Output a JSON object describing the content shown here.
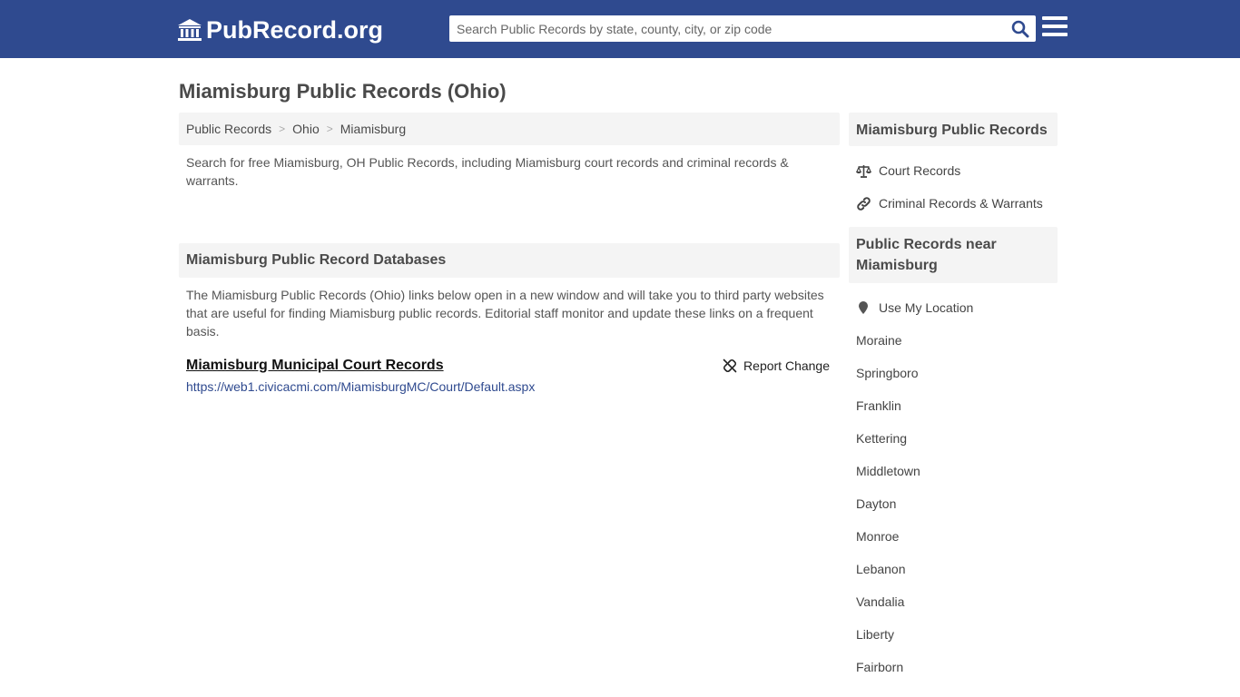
{
  "header": {
    "logo_text": "PubRecord.org",
    "search_placeholder": "Search Public Records by state, county, city, or zip code"
  },
  "page": {
    "title": "Miamisburg Public Records (Ohio)"
  },
  "breadcrumb": [
    "Public Records",
    "Ohio",
    "Miamisburg"
  ],
  "intro": "Search for free Miamisburg, OH Public Records, including Miamisburg court records and criminal records & warrants.",
  "databases": {
    "heading": "Miamisburg Public Record Databases",
    "description": "The Miamisburg Public Records (Ohio) links below open in a new window and will take you to third party websites that are useful for finding Miamisburg public records. Editorial staff monitor and update these links on a frequent basis.",
    "records": [
      {
        "title": "Miamisburg Municipal Court Records",
        "url": "https://web1.civicacmi.com/MiamisburgMC/Court/Default.aspx",
        "report_label": "Report Change"
      }
    ]
  },
  "sidebar": {
    "records_heading": "Miamisburg Public Records",
    "records_links": [
      {
        "label": "Court Records",
        "icon": "scale-icon"
      },
      {
        "label": "Criminal Records & Warrants",
        "icon": "link-icon"
      }
    ],
    "near_heading": "Public Records near Miamisburg",
    "use_location": "Use My Location",
    "nearby": [
      "Moraine",
      "Springboro",
      "Franklin",
      "Kettering",
      "Middletown",
      "Dayton",
      "Monroe",
      "Lebanon",
      "Vandalia",
      "Liberty",
      "Fairborn"
    ]
  },
  "colors": {
    "header_bg": "#2f4a8f",
    "panel_bg": "#f4f4f4",
    "link": "#2f4a8f"
  }
}
